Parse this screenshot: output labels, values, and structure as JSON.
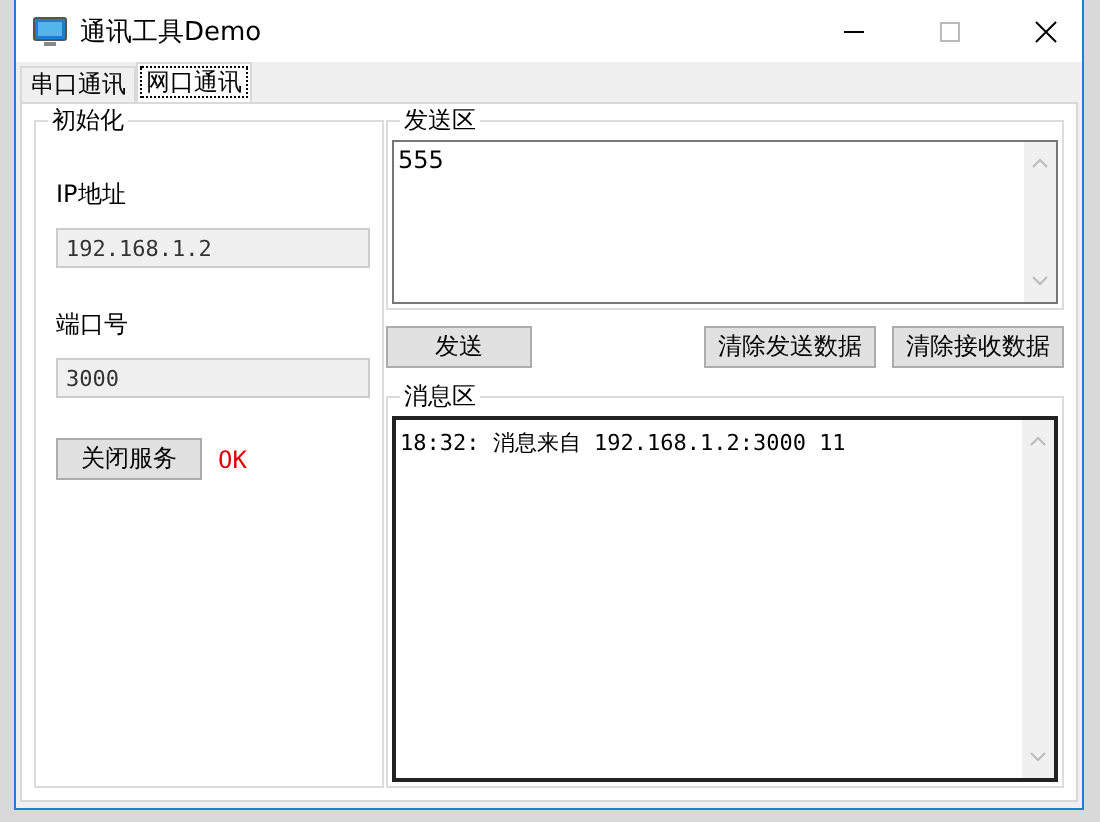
{
  "window": {
    "title": "通讯工具Demo"
  },
  "tabs": [
    {
      "label": "串口通讯",
      "selected": false
    },
    {
      "label": "网口通讯",
      "selected": true
    }
  ],
  "init_group": {
    "title": "初始化",
    "fields": [
      {
        "label": "IP地址",
        "value": "192.168.1.2",
        "disabled": true
      },
      {
        "label": "端口号",
        "value": "3000",
        "disabled": true
      }
    ],
    "service_button": "关闭服务",
    "status": "OK"
  },
  "send_group": {
    "title": "发送区",
    "value": "555"
  },
  "buttons": {
    "send": "发送",
    "clear_send": "清除发送数据",
    "clear_receive": "清除接收数据"
  },
  "message_group": {
    "title": "消息区",
    "lines": [
      "18:32: 消息来自 192.168.1.2:3000 11"
    ]
  }
}
